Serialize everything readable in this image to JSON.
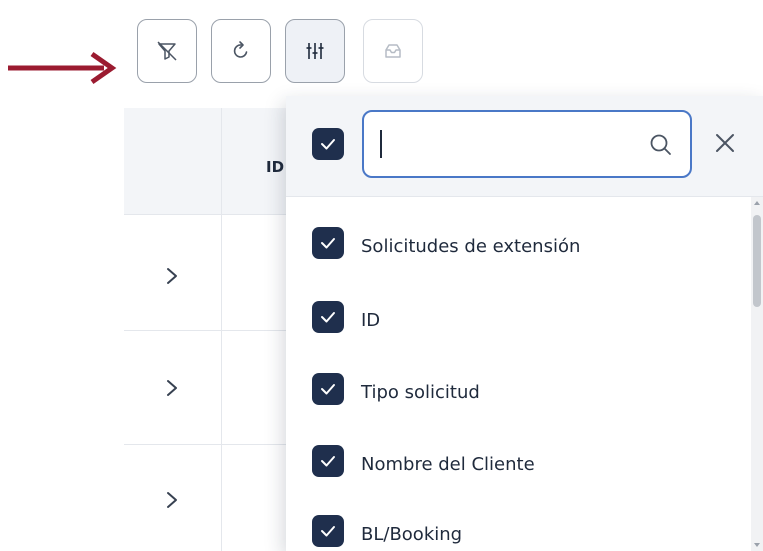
{
  "colors": {
    "annotation_arrow": "#9b1b30",
    "checkbox_fill": "#1f2f4d",
    "search_border": "#4a78c7",
    "header_background": "#f3f5f8"
  },
  "toolbar": {
    "buttons": [
      {
        "icon": "filter-off-icon",
        "state": "default"
      },
      {
        "icon": "refresh-icon",
        "state": "default"
      },
      {
        "icon": "column-settings-icon",
        "state": "active"
      },
      {
        "icon": "archive-icon",
        "state": "disabled"
      }
    ]
  },
  "table": {
    "header": {
      "id_label": "ID"
    },
    "rows": [
      {
        "expand_icon": "chevron-right-icon"
      },
      {
        "expand_icon": "chevron-right-icon"
      },
      {
        "expand_icon": "chevron-right-icon"
      }
    ]
  },
  "column_chooser": {
    "select_all_checked": true,
    "search": {
      "value": "",
      "placeholder": ""
    },
    "columns": [
      {
        "label": "Solicitudes de extensión",
        "checked": true
      },
      {
        "label": "ID",
        "checked": true
      },
      {
        "label": "Tipo solicitud",
        "checked": true
      },
      {
        "label": "Nombre del Cliente",
        "checked": true
      },
      {
        "label": "BL/Booking",
        "checked": true
      }
    ]
  }
}
